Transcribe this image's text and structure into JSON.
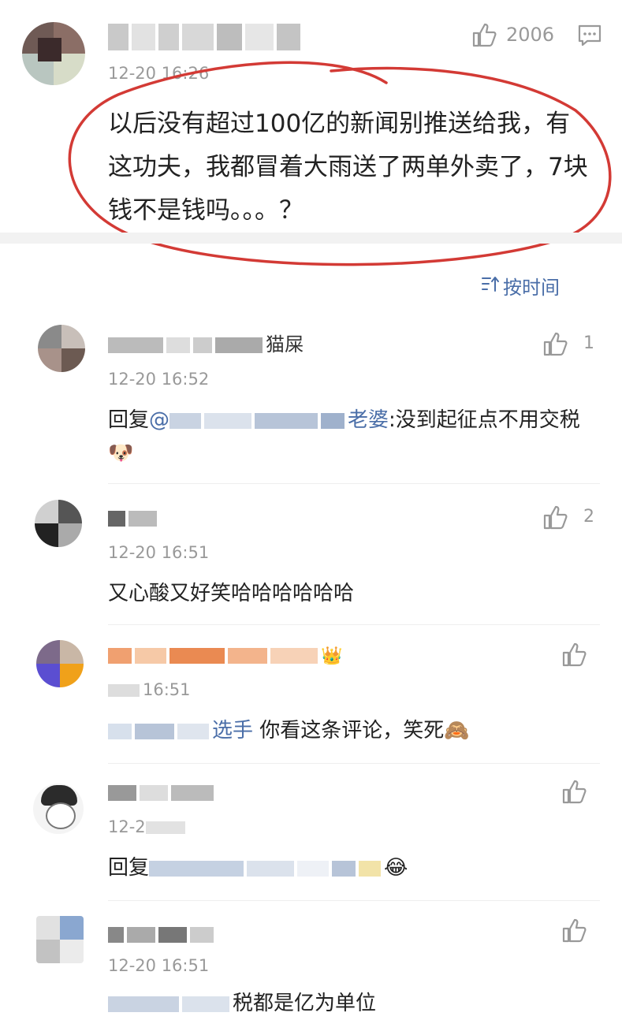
{
  "top_comment": {
    "time": "12-20 16:26",
    "likes": "2006",
    "text": "以后没有超过100亿的新闻别推送给我，有这功夫，我都冒着大雨送了两单外卖了，7块钱不是钱吗。。。？"
  },
  "sort": {
    "label": "按时间"
  },
  "replies": [
    {
      "name_visible": "猫屎",
      "time": "12-20 16:52",
      "likes": "1",
      "text_prefix": "回复",
      "mention_visible": "@",
      "mention_tail": "老婆",
      "text": ":没到起征点不用交税",
      "emoji": "🐶"
    },
    {
      "name_visible": "",
      "time": "12-20 16:51",
      "likes": "2",
      "text": "又心酸又好笑哈哈哈哈哈哈"
    },
    {
      "name_visible": "",
      "time": "16:51",
      "likes": "",
      "mention_tail": "选手",
      "text": " 你看这条评论，笑死",
      "emoji": "🙈",
      "badge": "👑"
    },
    {
      "name_visible": "",
      "time": "12-2",
      "likes": "",
      "text_prefix": "回复",
      "emoji": "😂"
    },
    {
      "name_visible": "",
      "time": "12-20 16:51",
      "likes": "",
      "text": "税都是亿为单位"
    }
  ]
}
